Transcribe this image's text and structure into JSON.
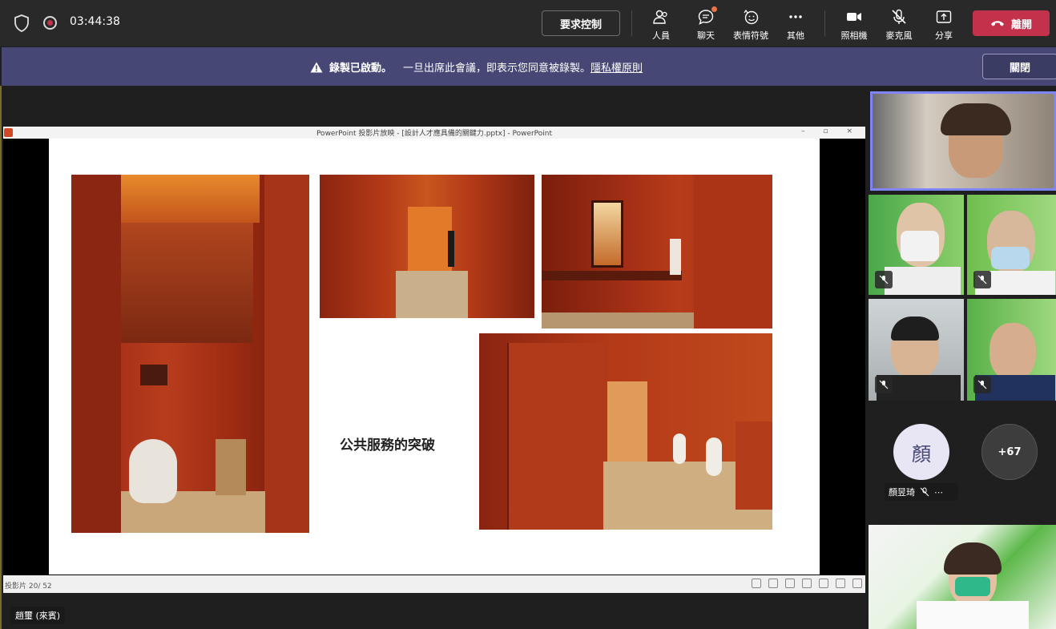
{
  "topbar": {
    "timer": "03:44:38",
    "request_control_label": "要求控制",
    "items": [
      {
        "label": "人員",
        "icon": "people-icon"
      },
      {
        "label": "聊天",
        "icon": "chat-icon"
      },
      {
        "label": "表情符號",
        "icon": "emoji-icon"
      },
      {
        "label": "其他",
        "icon": "more-icon"
      },
      {
        "label": "照相機",
        "icon": "camera-icon"
      },
      {
        "label": "麥克風",
        "icon": "mic-off-icon"
      },
      {
        "label": "分享",
        "icon": "share-icon"
      }
    ],
    "leave_label": "離開",
    "leave_color": "#c4314b"
  },
  "banner": {
    "bold": "錄製已啟動。",
    "text": "一旦出席此會議，即表示您同意被錄製。",
    "link": "隱私權原則",
    "close_label": "關閉",
    "color": "#464775"
  },
  "presentation": {
    "window_title": "PowerPoint 投影片放映 - [設計人才應具備的關鍵力.pptx] - PowerPoint",
    "slide_caption": "公共服務的突破",
    "status": "投影片 20/ 52"
  },
  "presenter_name": "趙璽 (來賓)",
  "participants": {
    "avatar_initial": "顏",
    "avatar_name": "顏昱琦",
    "more_count": "+67"
  }
}
